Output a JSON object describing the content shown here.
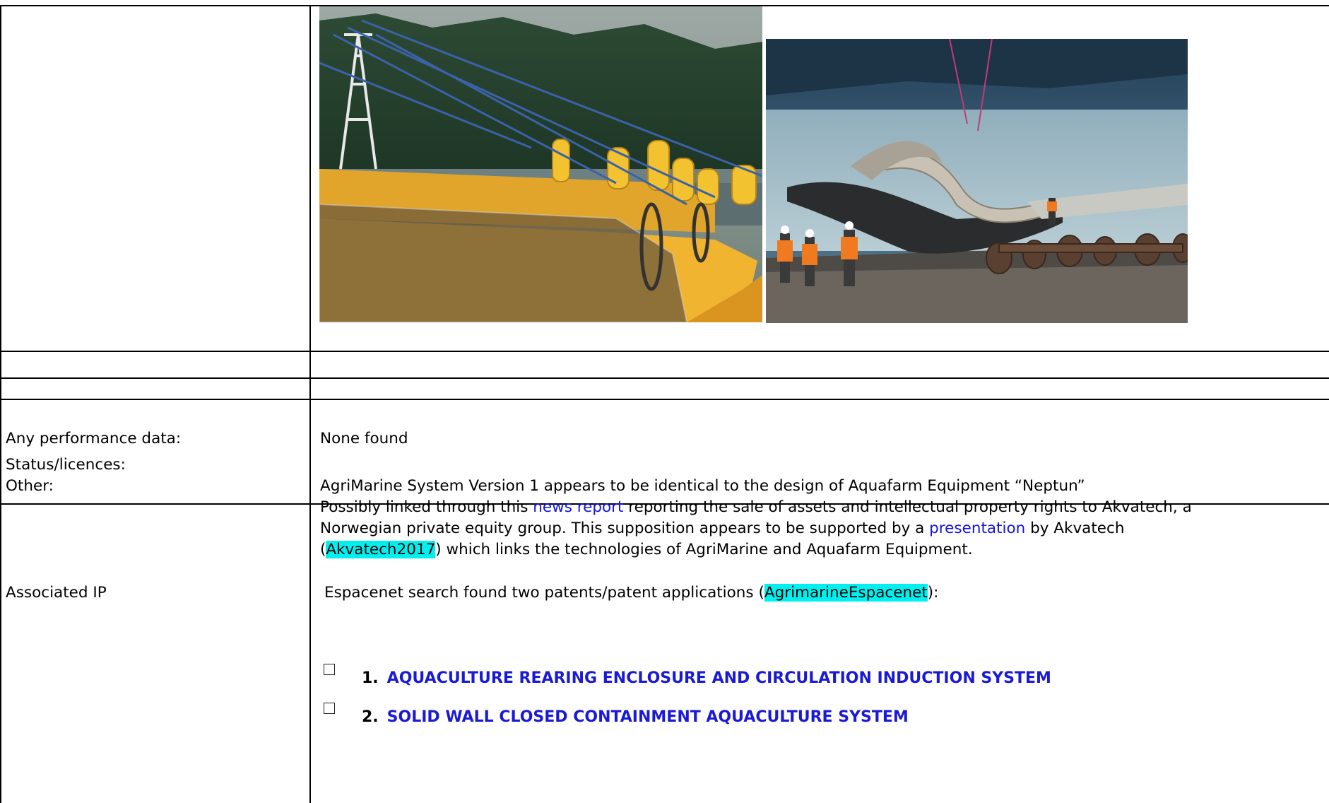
{
  "rows": [
    {
      "label": "Any performance data:",
      "value": "None found"
    },
    {
      "label": "Status/licences:",
      "value": ""
    },
    {
      "label": "Other:",
      "value": ""
    },
    {
      "label": "Associated IP",
      "value": ""
    }
  ],
  "other": {
    "line1": "AgriMarine System Version 1 appears to be identical to the design of Aquafarm Equipment “Neptun”",
    "line2_pre": "Possibly linked through this ",
    "line2_link": "news report",
    "line2_post": " reporting the sale of assets and intellectual property rights to Akvatech, a",
    "line3_pre": "Norwegian private equity group.  This supposition appears to be supported by a ",
    "line3_link": "presentation",
    "line3_post": " by Akvatech",
    "line4_pre": "(",
    "line4_ref": "Akvatech2017",
    "line4_post": ") which links the technologies of AgriMarine and Aquafarm Equipment."
  },
  "ip": {
    "intro_pre": "Espacenet search found two patents/patent applications (",
    "intro_ref": "AgrimarineEspacenet",
    "intro_post": "):",
    "patents": [
      {
        "num": "1.",
        "title": "AQUACULTURE REARING ENCLOSURE AND CIRCULATION INDUCTION SYSTEM"
      },
      {
        "num": "2.",
        "title": "SOLID WALL CLOSED CONTAINMENT AQUACULTURE SYSTEM"
      }
    ]
  },
  "colors": {
    "link": "#1414e0",
    "patent_link": "#1a1ad6",
    "highlight": "#00f0f0"
  }
}
